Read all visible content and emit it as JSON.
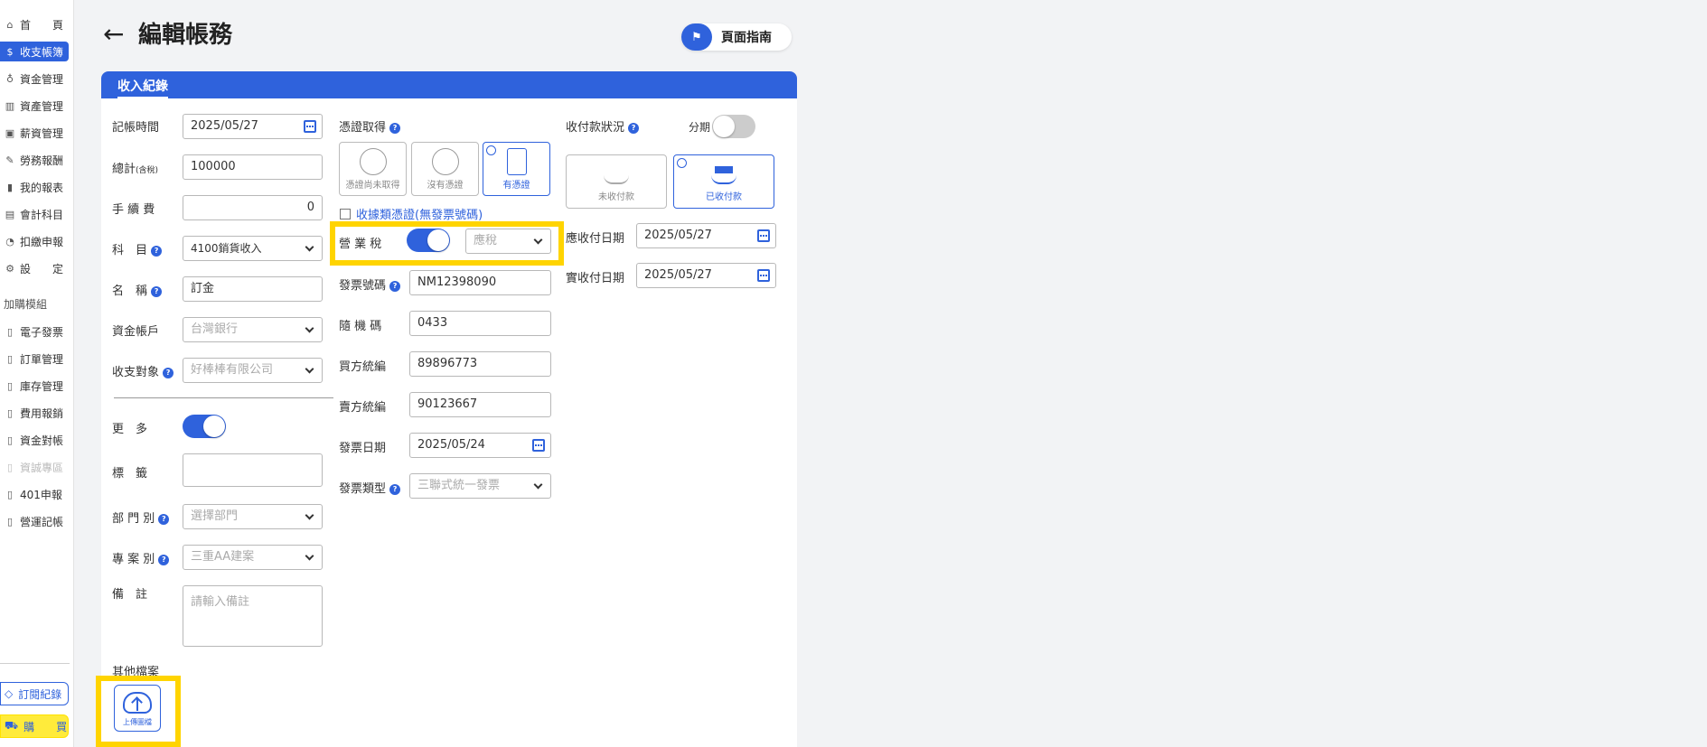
{
  "sidebar": {
    "items": [
      {
        "label": "首　　頁",
        "icon": "home-icon"
      },
      {
        "label": "收支帳簿",
        "icon": "money-circle-icon"
      },
      {
        "label": "資金管理",
        "icon": "fund-icon"
      },
      {
        "label": "資產管理",
        "icon": "building-icon"
      },
      {
        "label": "薪資管理",
        "icon": "salary-icon"
      },
      {
        "label": "勞務報酬",
        "icon": "labor-icon"
      },
      {
        "label": "我的報表",
        "icon": "chart-icon"
      },
      {
        "label": "會計科目",
        "icon": "ledger-icon"
      },
      {
        "label": "扣繳申報",
        "icon": "tax-icon"
      },
      {
        "label": "設　　定",
        "icon": "settings-icon"
      }
    ],
    "addon_title": "加購模組",
    "addons": [
      {
        "label": "電子發票"
      },
      {
        "label": "訂單管理"
      },
      {
        "label": "庫存管理"
      },
      {
        "label": "費用報銷"
      },
      {
        "label": "資金對帳"
      },
      {
        "label": "資誠專區"
      },
      {
        "label": "401申報"
      },
      {
        "label": "營運記帳"
      }
    ],
    "subscription_label": "訂閱紀錄",
    "buy_label": "購　　買"
  },
  "header": {
    "back": "←",
    "title": "編輯帳務",
    "guide_label": "頁面指南"
  },
  "card": {
    "tab": "收入紀錄"
  },
  "form": {
    "record_time_label": "記帳時間",
    "record_time": "2025/05/27",
    "total_label": "總計",
    "total_suffix": "(含稅)",
    "total": "100000",
    "fee_label": "手 續 費",
    "fee": "0",
    "subject_label": "科　目",
    "subject": "4100銷貨收入",
    "name_label": "名　稱",
    "name": "訂金",
    "account_label": "資金帳戶",
    "account": "台灣銀行",
    "counterparty_label": "收支對象",
    "counterparty": "好棒棒有限公司",
    "more_label": "更　多",
    "tag_label": "標　籤",
    "dept_label": "部 門 別",
    "dept_placeholder": "選擇部門",
    "project_label": "專 案 別",
    "project": "三重AA建案",
    "note_label": "備　註",
    "note_placeholder": "請輸入備註",
    "files_label": "其他檔案",
    "upload_label": "上傳圖檔"
  },
  "voucher": {
    "label": "憑證取得",
    "options": [
      {
        "label": "憑證尚未取得"
      },
      {
        "label": "沒有憑證"
      },
      {
        "label": "有憑證"
      }
    ],
    "receipt_checkbox": "收據類憑證(無發票號碼)",
    "tax_label": "營 業 稅",
    "tax_select": "應稅",
    "invoice_no_label": "發票號碼",
    "invoice_no": "NM12398090",
    "random_code_label": "隨 機 碼",
    "random_code": "0433",
    "buyer_id_label": "買方統編",
    "buyer_id": "89896773",
    "seller_id_label": "賣方統編",
    "seller_id": "90123667",
    "invoice_date_label": "發票日期",
    "invoice_date": "2025/05/24",
    "invoice_type_label": "發票類型",
    "invoice_type": "三聯式統一發票"
  },
  "payment": {
    "label": "收付款狀況",
    "installment_label": "分期",
    "options": [
      {
        "label": "未收付款"
      },
      {
        "label": "已收付款"
      }
    ],
    "due_date_label": "應收付日期",
    "due_date": "2025/05/27",
    "actual_date_label": "實收付日期",
    "actual_date": "2025/05/27"
  },
  "colors": {
    "accent": "#2f62dc",
    "highlight": "#ffd400"
  }
}
